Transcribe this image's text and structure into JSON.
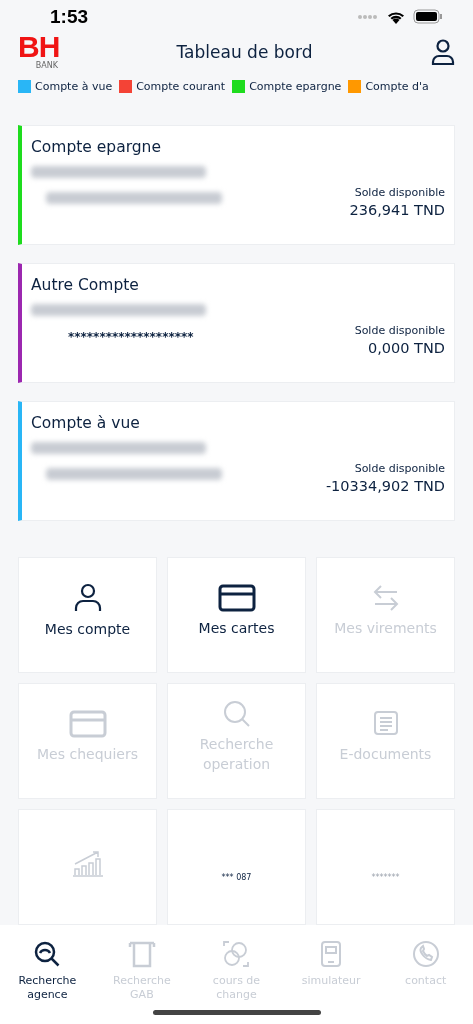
{
  "status_bar": {
    "time": "1:53"
  },
  "header": {
    "title": "Tableau de bord",
    "logo": {
      "letters": "BH",
      "sub": "BANK"
    }
  },
  "legend": [
    {
      "label": "Compte à vue",
      "color": "#29b6f6"
    },
    {
      "label": "Compte courant",
      "color": "#f44336"
    },
    {
      "label": "Compte epargne",
      "color": "#1edc1e"
    },
    {
      "label": "Compte d'a",
      "color": "#ff9800"
    }
  ],
  "accounts": [
    {
      "type": "Compte epargne",
      "color": "#1edc1e",
      "number_masked": false,
      "balance_label": "Solde disponible",
      "balance": "236,941 TND"
    },
    {
      "type": "Autre Compte",
      "color": "#9c27b0",
      "number_masked": true,
      "number": "********************",
      "balance_label": "Solde disponible",
      "balance": "0,000 TND"
    },
    {
      "type": "Compte à vue",
      "color": "#29b6f6",
      "number_masked": false,
      "balance_label": "Solde disponible",
      "balance": "-10334,902 TND"
    }
  ],
  "tiles": [
    {
      "label": "Mes compte",
      "disabled": false
    },
    {
      "label": "Mes cartes",
      "disabled": false
    },
    {
      "label": "Mes virements",
      "disabled": true
    },
    {
      "label": "Mes chequiers",
      "disabled": true
    },
    {
      "label": "Recherche operation",
      "disabled": true
    },
    {
      "label": "E-documents",
      "disabled": true
    },
    {
      "disabled": true
    },
    {
      "caption": "*** 087",
      "disabled": false
    },
    {
      "caption": "*******",
      "disabled": true
    }
  ],
  "bottom_nav": [
    {
      "label": "Recherche agence",
      "selected": true
    },
    {
      "label": "Recherche GAB",
      "selected": false
    },
    {
      "label": "cours de change",
      "selected": false
    },
    {
      "label": "simulateur",
      "selected": false
    },
    {
      "label": "contact",
      "selected": false
    }
  ]
}
